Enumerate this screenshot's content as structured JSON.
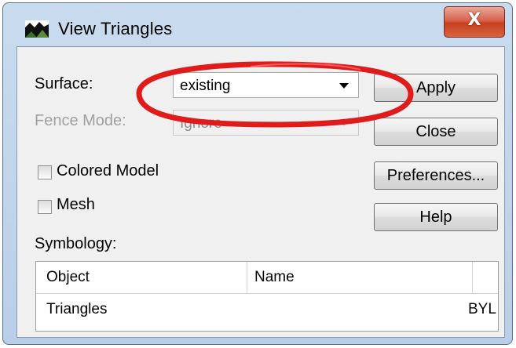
{
  "window": {
    "title": "View Triangles",
    "close_glyph": "X"
  },
  "form": {
    "surface_label": "Surface:",
    "surface_value": "existing",
    "fence_label": "Fence Mode:",
    "fence_value": "Ignore",
    "colored_model_label": "Colored Model",
    "mesh_label": "Mesh",
    "symbology_label": "Symbology:",
    "colored_model_checked": false,
    "mesh_checked": false
  },
  "buttons": {
    "apply": "Apply",
    "close": "Close",
    "preferences": "Preferences...",
    "help": "Help"
  },
  "table": {
    "columns": [
      "Object",
      "Name"
    ],
    "rows": [
      {
        "object": "Triangles",
        "name": "",
        "symbology": "BYL"
      }
    ]
  },
  "icons": [
    "view-triangles-app-icon",
    "close-icon",
    "dropdown-arrow-icon",
    "checkbox-icon"
  ],
  "colors": {
    "highlight": "#e01b1b",
    "close_button": "#c6401f",
    "title_bar": "#c9dbee"
  }
}
